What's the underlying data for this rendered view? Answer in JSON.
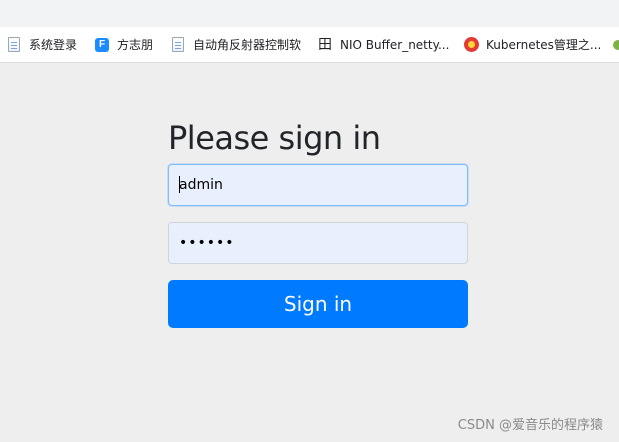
{
  "bookmarks": [
    {
      "label": "系统登录",
      "icon": "page-icon"
    },
    {
      "label": "方志朋",
      "icon": "f-logo-icon"
    },
    {
      "label": "自动角反射器控制软",
      "icon": "page-icon"
    },
    {
      "label": "NIO Buffer_netty...",
      "icon": "tian-icon"
    },
    {
      "label": "Kubernetes管理之...",
      "icon": "kubernetes-icon"
    }
  ],
  "form": {
    "heading": "Please sign in",
    "username_value": "admin",
    "password_value": "••••••",
    "submit_label": "Sign in"
  },
  "watermark": "CSDN @爱音乐的程序猿",
  "colors": {
    "primary": "#007bff",
    "page_background": "#eeeeee",
    "autofill_background": "#e8f0fe"
  }
}
